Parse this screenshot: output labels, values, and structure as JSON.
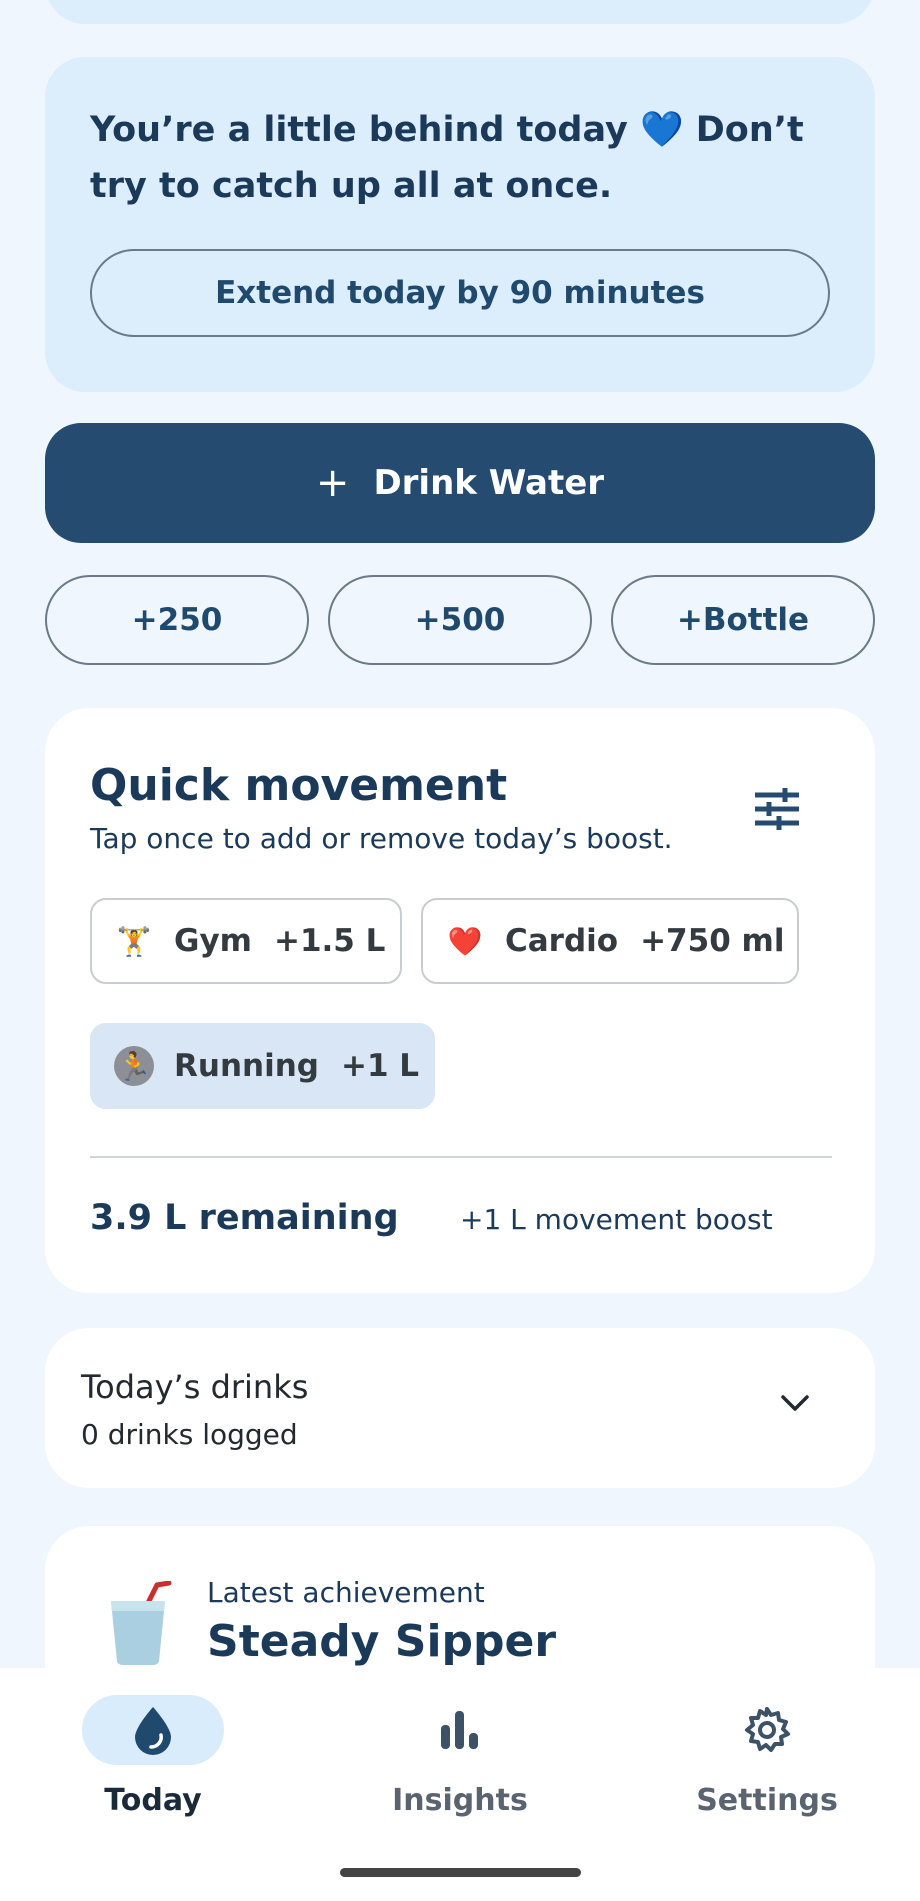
{
  "nudge": {
    "message": "You’re a little behind today 💙 Don’t try to catch up all at once.",
    "extend_label": "Extend today by 90 minutes"
  },
  "drink_button": {
    "plus": "+",
    "label": "Drink Water"
  },
  "quick_add": [
    "+250",
    "+500",
    "+Bottle"
  ],
  "movement": {
    "title": "Quick movement",
    "subtitle": "Tap once to add or remove today’s boost.",
    "settings_icon": "tune-icon",
    "chips": [
      {
        "emoji": "🏋️",
        "name": "Gym",
        "amount": "+1.5 L",
        "active": false
      },
      {
        "emoji": "❤️",
        "name": "Cardio",
        "amount": "+750 ml",
        "active": false
      },
      {
        "emoji": "🏃",
        "name": "Running",
        "amount": "+1 L",
        "active": true
      }
    ],
    "remaining": "3.9 L remaining",
    "boost": "+1 L movement boost"
  },
  "drinks": {
    "title": "Today’s drinks",
    "count": "0 drinks logged"
  },
  "achievement": {
    "label": "Latest achievement",
    "name": "Steady Sipper"
  },
  "tabs": [
    {
      "label": "Today",
      "icon": "drop-icon",
      "active": true
    },
    {
      "label": "Insights",
      "icon": "bar-chart-icon",
      "active": false
    },
    {
      "label": "Settings",
      "icon": "gear-icon",
      "active": false
    }
  ],
  "colors": {
    "background": "#f0f6fd",
    "accent": "#254c70",
    "card_tint": "#dcedfc"
  }
}
